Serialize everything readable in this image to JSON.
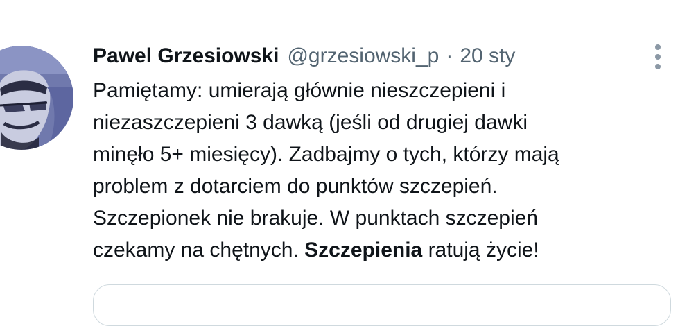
{
  "tweet": {
    "author": {
      "display_name": "Pawel Grzesiowski",
      "handle": "@grzesiowski_p"
    },
    "separator": "·",
    "date": "20 sty",
    "body_lines": [
      "Pamiętamy: umierają głównie nieszczepieni i",
      "niezaszczepieni 3 dawką (jeśli od drugiej dawki",
      "minęło 5+ miesięcy). Zadbajmy o tych, którzy mają",
      "problem z dotarciem do punktów szczepień.",
      "Szczepionek nie brakuje. W punktach szczepień"
    ],
    "last_line": {
      "before": "czekamy na chętnych. ",
      "bold": "Szczepienia",
      "after": " ratują życie!"
    }
  },
  "icons": {
    "more": "more-vertical-icon",
    "avatar": "avatar-photo"
  },
  "colors": {
    "text_primary": "#0f1419",
    "text_secondary": "#536471",
    "divider": "#eff3f4",
    "card_border": "#cfd9de",
    "avatar_tint": "#6f79ad"
  }
}
